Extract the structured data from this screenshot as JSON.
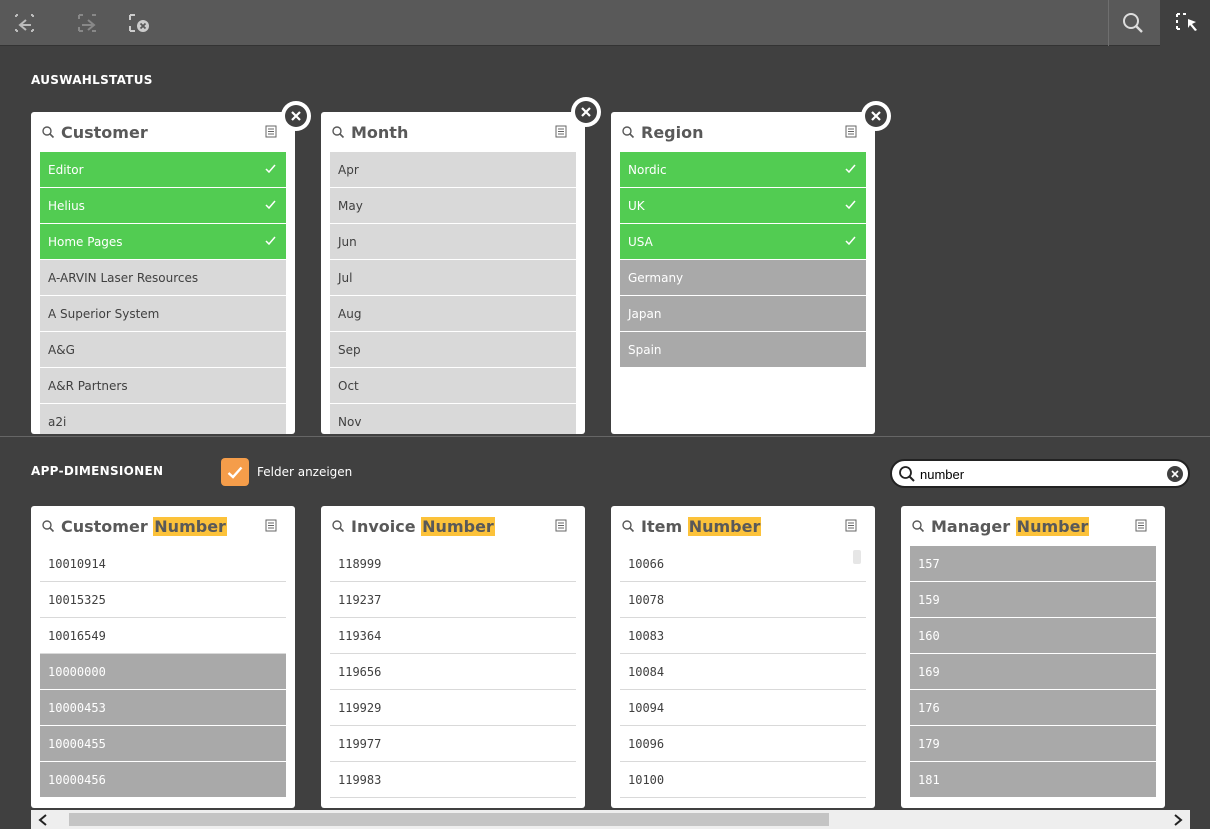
{
  "toolbar": {
    "buttons": [
      "step-back",
      "step-forward",
      "clear-all"
    ],
    "right_buttons": [
      "search",
      "selection-tool"
    ]
  },
  "selections_section": {
    "title": "AUSWAHLSTATUS",
    "boxes": [
      {
        "title": "Customer",
        "rows": [
          {
            "label": "Editor",
            "state": "sel"
          },
          {
            "label": "Helius",
            "state": "sel"
          },
          {
            "label": "Home Pages",
            "state": "sel"
          },
          {
            "label": "A-ARVIN Laser Resources",
            "state": "opt"
          },
          {
            "label": "A Superior System",
            "state": "opt"
          },
          {
            "label": "A&G",
            "state": "opt"
          },
          {
            "label": "A&R Partners",
            "state": "opt"
          },
          {
            "label": "a2i",
            "state": "opt"
          }
        ]
      },
      {
        "title": "Month",
        "rows": [
          {
            "label": "Apr",
            "state": "opt"
          },
          {
            "label": "May",
            "state": "opt"
          },
          {
            "label": "Jun",
            "state": "opt"
          },
          {
            "label": "Jul",
            "state": "opt"
          },
          {
            "label": "Aug",
            "state": "opt"
          },
          {
            "label": "Sep",
            "state": "opt"
          },
          {
            "label": "Oct",
            "state": "opt"
          },
          {
            "label": "Nov",
            "state": "opt"
          }
        ]
      },
      {
        "title": "Region",
        "rows": [
          {
            "label": "Nordic",
            "state": "sel"
          },
          {
            "label": "UK",
            "state": "sel"
          },
          {
            "label": "USA",
            "state": "sel"
          },
          {
            "label": "Germany",
            "state": "exc"
          },
          {
            "label": "Japan",
            "state": "exc"
          },
          {
            "label": "Spain",
            "state": "exc"
          }
        ]
      }
    ]
  },
  "dimensions_section": {
    "title": "APP-DIMENSIONEN",
    "show_fields_label": "Felder anzeigen",
    "show_fields_checked": true,
    "search": {
      "value": "number",
      "placeholder": ""
    },
    "highlight": "Number",
    "boxes": [
      {
        "title_prefix": "Customer ",
        "rows": [
          {
            "label": "10010914",
            "state": "poss"
          },
          {
            "label": "10015325",
            "state": "poss"
          },
          {
            "label": "10016549",
            "state": "poss"
          },
          {
            "label": "10000000",
            "state": "exc"
          },
          {
            "label": "10000453",
            "state": "exc"
          },
          {
            "label": "10000455",
            "state": "exc"
          },
          {
            "label": "10000456",
            "state": "exc"
          }
        ]
      },
      {
        "title_prefix": "Invoice ",
        "rows": [
          {
            "label": "118999",
            "state": "poss"
          },
          {
            "label": "119237",
            "state": "poss"
          },
          {
            "label": "119364",
            "state": "poss"
          },
          {
            "label": "119656",
            "state": "poss"
          },
          {
            "label": "119929",
            "state": "poss"
          },
          {
            "label": "119977",
            "state": "poss"
          },
          {
            "label": "119983",
            "state": "poss"
          }
        ]
      },
      {
        "title_prefix": "Item ",
        "rows": [
          {
            "label": "10066",
            "state": "poss"
          },
          {
            "label": "10078",
            "state": "poss"
          },
          {
            "label": "10083",
            "state": "poss"
          },
          {
            "label": "10084",
            "state": "poss"
          },
          {
            "label": "10094",
            "state": "poss"
          },
          {
            "label": "10096",
            "state": "poss"
          },
          {
            "label": "10100",
            "state": "poss"
          }
        ]
      },
      {
        "title_prefix": "Manager ",
        "rows": [
          {
            "label": "157",
            "state": "exc"
          },
          {
            "label": "159",
            "state": "exc"
          },
          {
            "label": "160",
            "state": "exc"
          },
          {
            "label": "169",
            "state": "exc"
          },
          {
            "label": "176",
            "state": "exc"
          },
          {
            "label": "179",
            "state": "exc"
          },
          {
            "label": "181",
            "state": "exc"
          }
        ]
      }
    ]
  },
  "colors": {
    "selected": "#52cc52",
    "optional": "#d9d9d9",
    "excluded": "#a9a9a9",
    "highlight": "#fcc23a",
    "checkbox": "#f59d4a"
  }
}
